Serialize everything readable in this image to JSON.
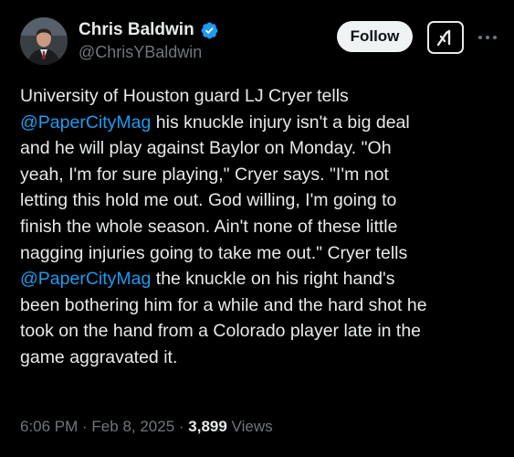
{
  "author": {
    "display_name": "Chris Baldwin",
    "handle": "@ChrisYBaldwin",
    "verified": true
  },
  "actions": {
    "follow_label": "Follow",
    "grok_icon": "grok-icon",
    "more_icon": "more-options-icon"
  },
  "tweet": {
    "lines": [
      [
        {
          "text": "University of Houston guard LJ Cryer tells"
        }
      ],
      [
        {
          "text": "@PaperCityMag",
          "mention": true
        },
        {
          "text": " his knuckle injury isn't a big deal"
        }
      ],
      [
        {
          "text": "and he will play against Baylor on Monday. \"Oh"
        }
      ],
      [
        {
          "text": "yeah, I'm for sure playing,\" Cryer says. \"I'm not"
        }
      ],
      [
        {
          "text": "letting this hold me out. God willing, I'm going to"
        }
      ],
      [
        {
          "text": "finish the whole season. Ain't none of these little"
        }
      ],
      [
        {
          "text": "nagging injuries going to take me out.\" Cryer tells"
        }
      ],
      [
        {
          "text": "@PaperCityMag",
          "mention": true
        },
        {
          "text": " the knuckle on his right hand's"
        }
      ],
      [
        {
          "text": "been bothering him for a while and the hard shot he"
        }
      ],
      [
        {
          "text": "took on the hand from a Colorado player late in the"
        }
      ],
      [
        {
          "text": "game aggravated it."
        }
      ]
    ]
  },
  "meta": {
    "time": "6:06 PM",
    "separator": " · ",
    "date": "Feb 8, 2025",
    "views_count": "3,899",
    "views_label": " Views"
  },
  "colors": {
    "background": "#000000",
    "text": "#e7e9ea",
    "secondary": "#71767b",
    "link": "#1d9bf0",
    "verified": "#1d9bf0"
  }
}
